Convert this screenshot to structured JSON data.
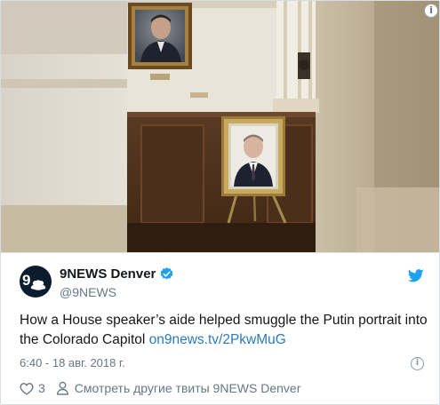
{
  "colors": {
    "link": "#2b7bb9",
    "verified": "#1da1f2",
    "secondary_text": "#657786",
    "avatar_bg": "#0b1c2e"
  },
  "media": {
    "icon": "image-info-icon",
    "info_glyph": "i"
  },
  "author": {
    "name": "9NEWS Denver",
    "handle": "@9NEWS",
    "avatar_text": "9",
    "verified_icon": "verified-badge-icon"
  },
  "tweet": {
    "text": "How a House speaker’s aide helped smuggle the Putin portrait into the Colorado Capitol ",
    "link": "on9news.tv/2PkwMuG",
    "timestamp": "6:40 - 18 авг. 2018 г.",
    "info_glyph": "i"
  },
  "actions": {
    "like_icon": "heart-icon",
    "like_count": "3",
    "more_icon": "person-icon",
    "more_label": "Смотреть другие твиты 9NEWS Denver"
  },
  "branding": {
    "logo_icon": "twitter-bird-icon"
  }
}
